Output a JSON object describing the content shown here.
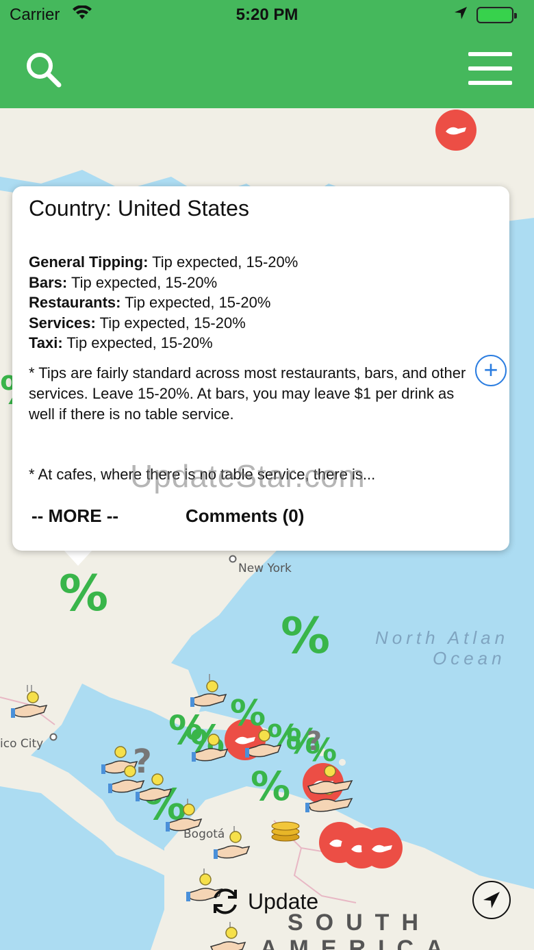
{
  "status_bar": {
    "carrier": "Carrier",
    "time": "5:20 PM"
  },
  "nav": {
    "search_icon": "search-icon",
    "menu_icon": "hamburger-menu-icon"
  },
  "callout": {
    "title": "Country: United States",
    "tips": [
      {
        "label": "General Tipping:",
        "value": " Tip expected, 15-20%"
      },
      {
        "label": "Bars:",
        "value": " Tip expected, 15-20%"
      },
      {
        "label": "Restaurants:",
        "value": " Tip expected, 15-20%"
      },
      {
        "label": "Services:",
        "value": " Tip expected, 15-20%"
      },
      {
        "label": "Taxi:",
        "value": " Tip expected, 15-20%"
      }
    ],
    "note_1": "* Tips are fairly standard across most restaurants, bars, and other services. Leave 15-20%. At bars, you may leave $1 per drink as well if there is no table service.",
    "note_2": "* At cafes, where there is no table service, there is...",
    "more_label": "-- MORE --",
    "comments_label": "Comments (0)"
  },
  "map": {
    "labels": {
      "new_york": "New York",
      "mexico_city": "ico City",
      "bogota": "Bogotá",
      "ocean_line1": "North Atlan",
      "ocean_line2": "Ocean",
      "south_america_1": "SOUTH",
      "south_america_2": "AMERICA"
    },
    "percent_symbol": "%",
    "question_symbol": "?"
  },
  "watermark": "UpdateStar.com",
  "update_label": "Update",
  "colors": {
    "brand_green": "#45b85c",
    "marker_red": "#ec4e45",
    "percent_green": "#39b54a",
    "link_blue": "#2b7de0"
  }
}
